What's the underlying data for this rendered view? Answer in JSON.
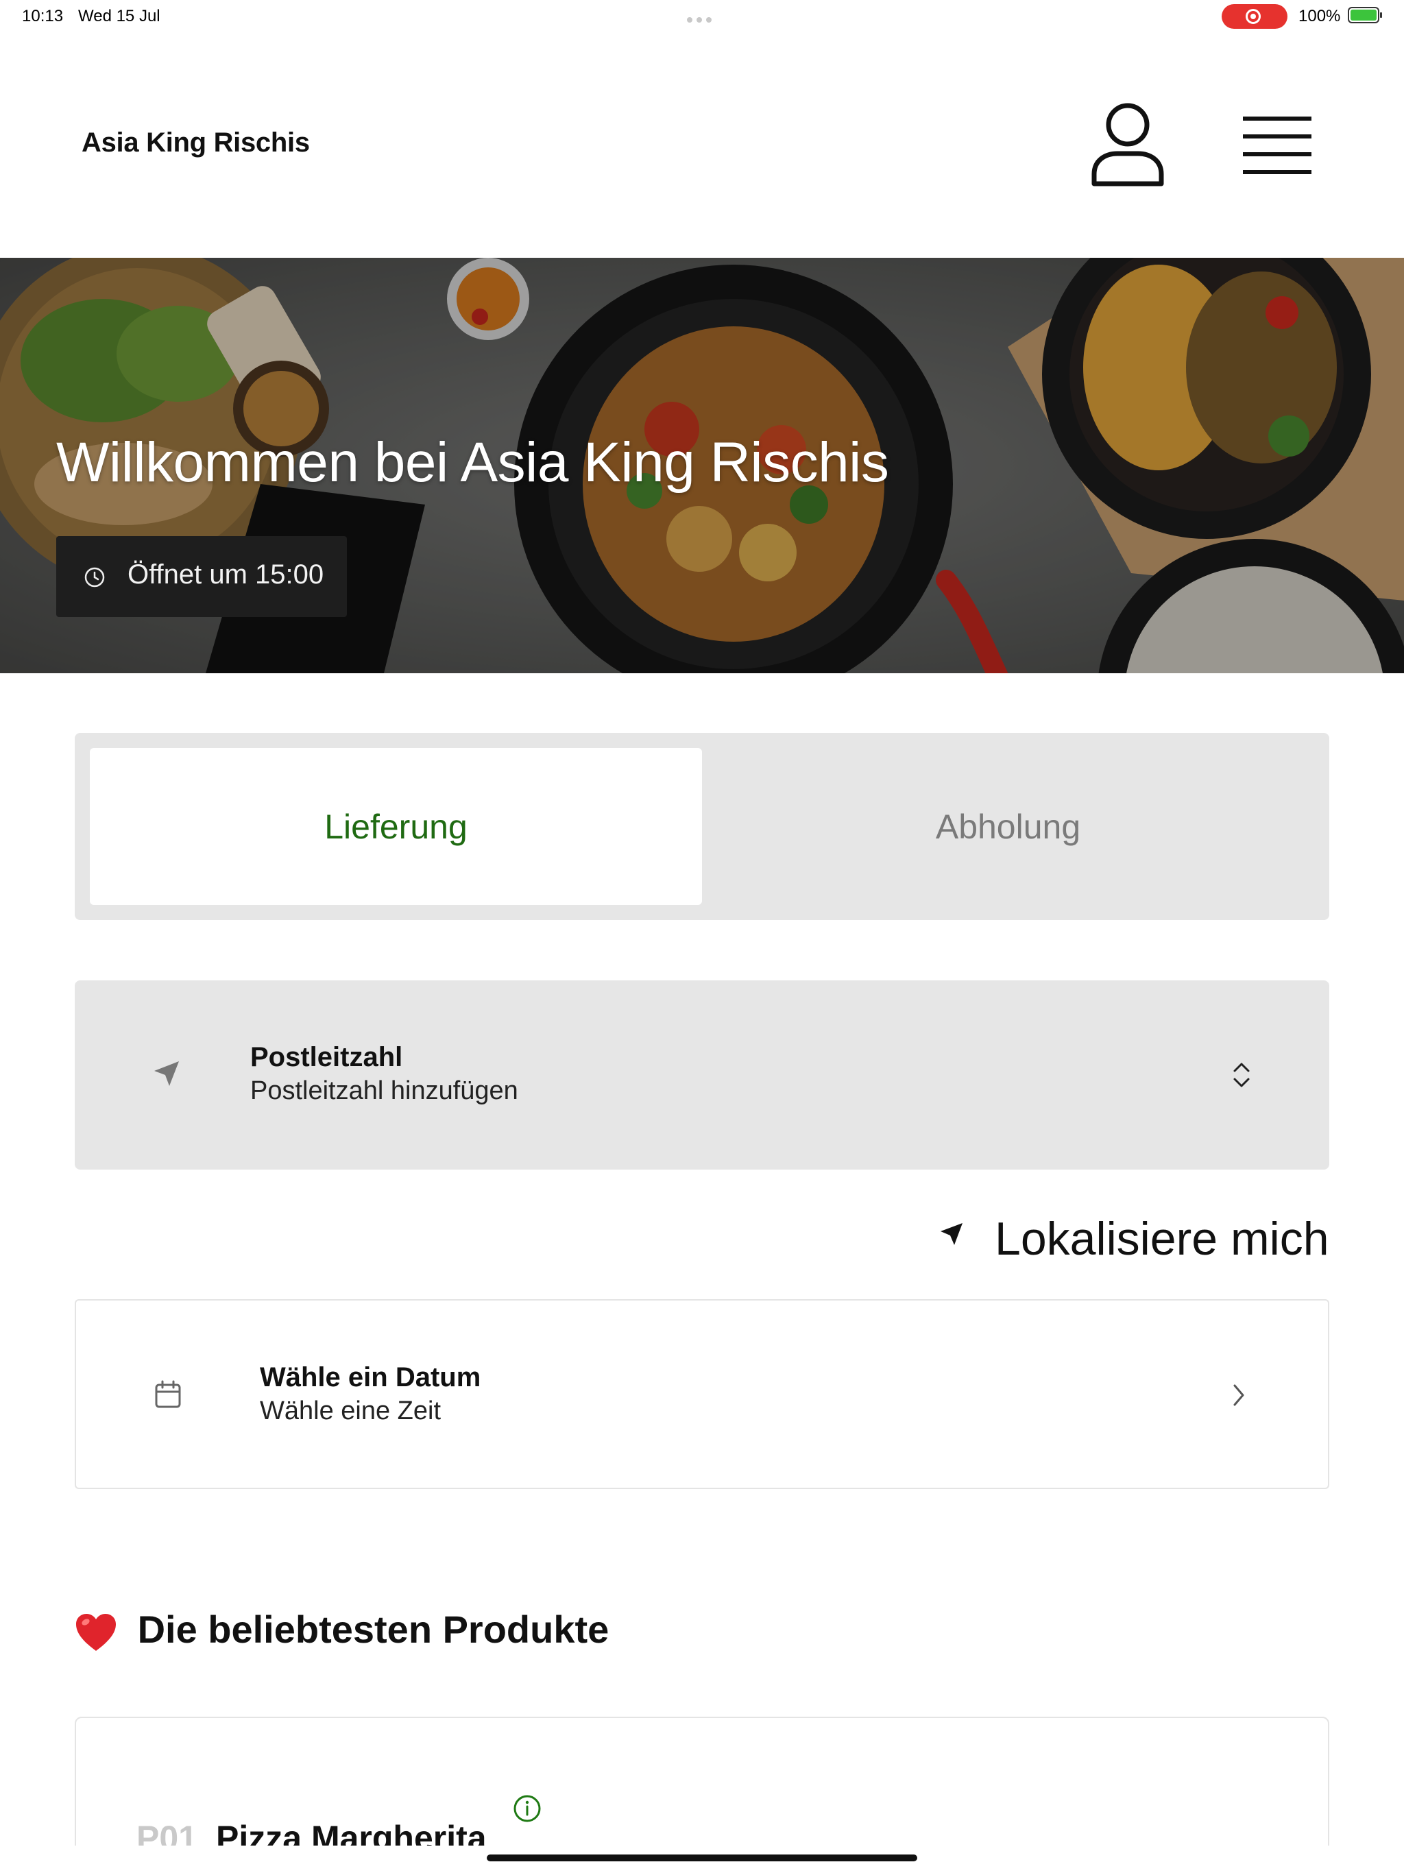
{
  "status_bar": {
    "time": "10:13",
    "date": "Wed 15 Jul",
    "battery_percent": "100%",
    "battery_level": 1.0,
    "recording_color": "#e6322e"
  },
  "header": {
    "brand": "Asia King Rischis",
    "icons": [
      "user-icon",
      "menu-icon"
    ]
  },
  "hero": {
    "title": "Willkommen bei Asia King Rischis",
    "opening_text": "Öffnet um 15:00",
    "icon": "clock-icon"
  },
  "tabs": [
    {
      "label": "Lieferung",
      "active": true,
      "color": "#1f6a12"
    },
    {
      "label": "Abholung",
      "active": false,
      "color": "#7a7a7a"
    }
  ],
  "postcode": {
    "title": "Postleitzahl",
    "subtitle": "Postleitzahl hinzufügen",
    "icon": "navigation-arrow-icon",
    "trailing_icon": "chevron-up-down-icon"
  },
  "locate": {
    "label": "Lokalisiere mich",
    "icon": "location-arrow-icon"
  },
  "schedule": {
    "title": "Wähle ein Datum",
    "subtitle": "Wähle eine Zeit",
    "icon": "calendar-icon",
    "trailing_icon": "chevron-right-icon"
  },
  "popular": {
    "title": "Die beliebtesten Produkte",
    "icon": "heart-icon",
    "products": [
      {
        "code": "P01",
        "name": "Pizza Margherita",
        "icon": "info-icon"
      }
    ]
  }
}
